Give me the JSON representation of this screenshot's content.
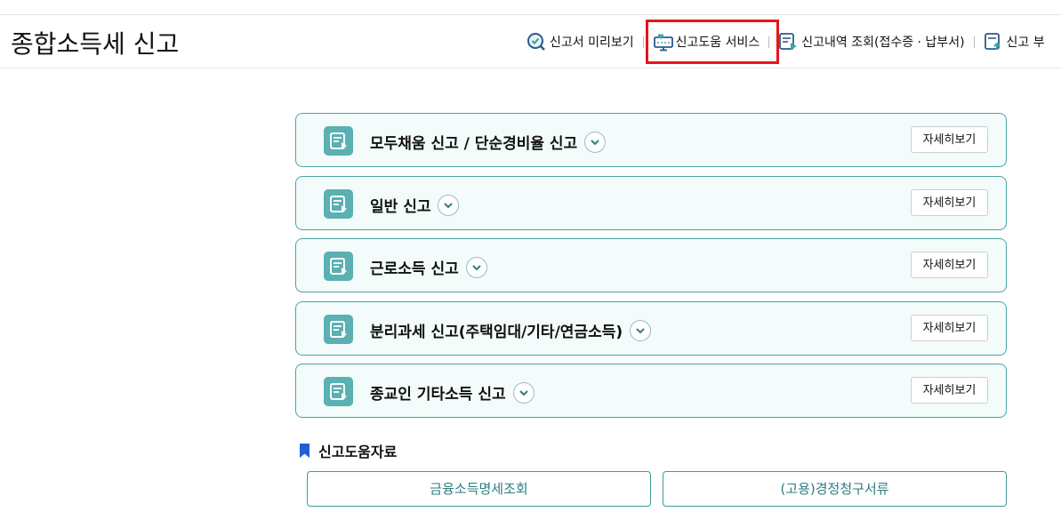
{
  "page": {
    "title": "종합소득세 신고"
  },
  "top_links": [
    {
      "label": "신고서 미리보기",
      "icon": "magnify-check-icon"
    },
    {
      "label": "신고도움 서비스",
      "icon": "monitor-heart-icon",
      "highlighted": true
    },
    {
      "label": "신고내역 조회(접수증 · 납부서)",
      "icon": "document-play-icon"
    },
    {
      "label": "신고 부",
      "icon": "document-upload-icon"
    }
  ],
  "cards": [
    {
      "title": "모두채움 신고 / 단순경비율 신고",
      "detail_label": "자세히보기"
    },
    {
      "title": "일반 신고",
      "detail_label": "자세히보기"
    },
    {
      "title": "근로소득 신고",
      "detail_label": "자세히보기"
    },
    {
      "title": "분리과세 신고(주택임대/기타/연금소득)",
      "detail_label": "자세히보기"
    },
    {
      "title": "종교인 기타소득 신고",
      "detail_label": "자세히보기"
    }
  ],
  "resources": {
    "heading": "신고도움자료",
    "buttons": [
      "금융소득명세조회",
      "(고용)경정청구서류"
    ]
  },
  "colors": {
    "accent": "#4aa3a5",
    "icon_bg": "#5ab0b2",
    "highlight": "#e3161b",
    "bookmark": "#1f5fd6"
  }
}
